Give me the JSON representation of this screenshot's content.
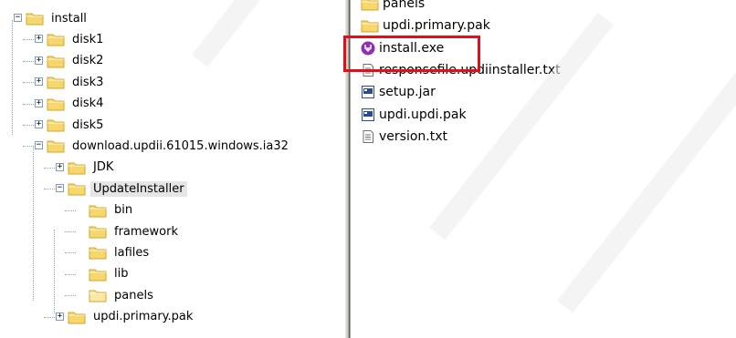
{
  "tree": [
    {
      "id": "install",
      "label": "install",
      "expander": "−",
      "indent": 0
    },
    {
      "id": "disk1",
      "label": "disk1",
      "expander": "+",
      "indent": 1
    },
    {
      "id": "disk2",
      "label": "disk2",
      "expander": "+",
      "indent": 1
    },
    {
      "id": "disk3",
      "label": "disk3",
      "expander": "+",
      "indent": 1
    },
    {
      "id": "disk4",
      "label": "disk4",
      "expander": "+",
      "indent": 1
    },
    {
      "id": "disk5",
      "label": "disk5",
      "expander": "+",
      "indent": 1
    },
    {
      "id": "download",
      "label": "download.updii.61015.windows.ia32",
      "expander": "−",
      "indent": 1
    },
    {
      "id": "jdk",
      "label": "JDK",
      "expander": "+",
      "indent": 2
    },
    {
      "id": "updateinstaller",
      "label": "UpdateInstaller",
      "expander": "−",
      "indent": 2,
      "selected": true
    },
    {
      "id": "bin",
      "label": "bin",
      "indent": 3
    },
    {
      "id": "framework",
      "label": "framework",
      "indent": 3
    },
    {
      "id": "lafiles",
      "label": "lafiles",
      "indent": 3
    },
    {
      "id": "lib",
      "label": "lib",
      "indent": 3
    },
    {
      "id": "panels",
      "label": "panels",
      "indent": 3
    },
    {
      "id": "updi-primary-pak",
      "label": "updi.primary.pak",
      "expander": "+",
      "indent": 2
    }
  ],
  "files": [
    {
      "id": "panels",
      "label": "panels",
      "icon": "folder-icon"
    },
    {
      "id": "updi-primary-pak",
      "label": "updi.primary.pak",
      "icon": "folder-icon"
    },
    {
      "id": "install-exe",
      "label": "install.exe",
      "icon": "installer-icon"
    },
    {
      "id": "responsefile",
      "label": "responsefile.updiinstaller.txt",
      "icon": "text-file-icon"
    },
    {
      "id": "setup-jar",
      "label": "setup.jar",
      "icon": "jar-file-icon"
    },
    {
      "id": "updi-updi-pak",
      "label": "updi.updi.pak",
      "icon": "jar-file-icon"
    },
    {
      "id": "version-txt",
      "label": "version.txt",
      "icon": "text-file-icon"
    }
  ],
  "colors": {
    "folder": "#f5d76e",
    "folder_dark": "#d4a62a",
    "highlight": "#e0101b",
    "installer": "#8e2fb5"
  }
}
